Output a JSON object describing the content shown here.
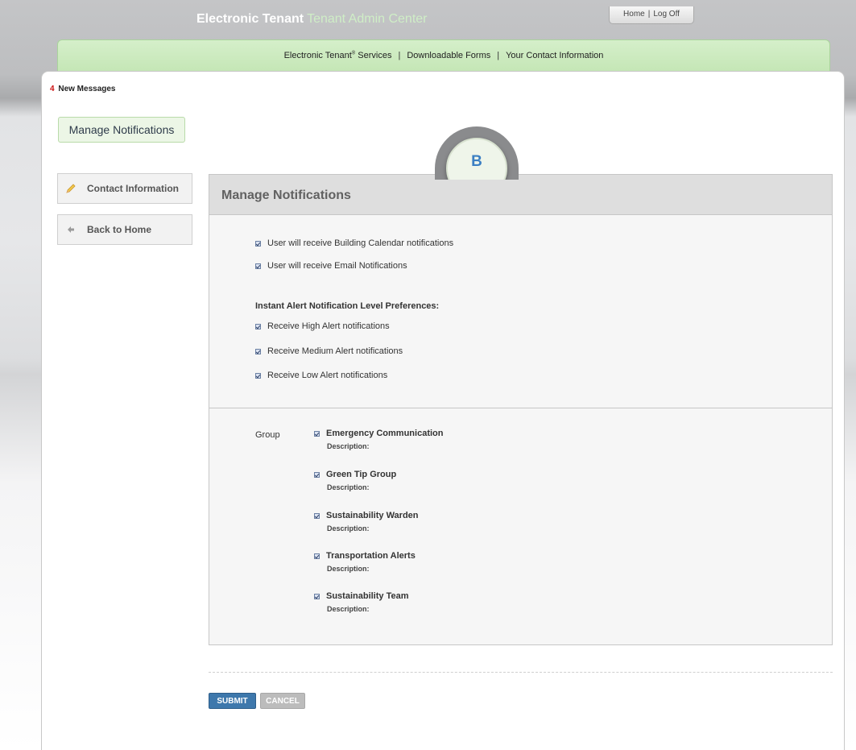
{
  "header": {
    "brand": "Electronic Tenant",
    "brand_sub": "Tenant Admin Center",
    "links": {
      "home": "Home",
      "sep": "|",
      "logoff": "Log Off"
    }
  },
  "nav": {
    "services_label": "Electronic Tenant",
    "services_suffix": " Services",
    "services_sup": "®",
    "forms": "Downloadable Forms",
    "contact": "Your Contact Information",
    "sep": "|"
  },
  "messages": {
    "count": "4",
    "label": "New Messages"
  },
  "page_title": "Manage Notifications",
  "sidebar": {
    "contact_label": "Contact Information",
    "back_label": "Back to Home"
  },
  "badge": {
    "letter": "B"
  },
  "panel": {
    "title": "Manage Notifications",
    "notifications": [
      "User will receive Building Calendar notifications",
      "User will receive Email Notifications"
    ],
    "alert_heading": "Instant Alert Notification Level Preferences:",
    "alerts": [
      "Receive High Alert notifications",
      "Receive Medium Alert notifications",
      "Receive Low Alert notifications"
    ],
    "group_label": "Group",
    "groups": [
      {
        "name": "Emergency Communication",
        "description": "Description:"
      },
      {
        "name": "Green Tip Group",
        "description": "Description:"
      },
      {
        "name": "Sustainability Warden",
        "description": "Description:"
      },
      {
        "name": "Transportation Alerts",
        "description": "Description:"
      },
      {
        "name": "Sustainability Team",
        "description": "Description:"
      }
    ]
  },
  "actions": {
    "submit": "SUBMIT",
    "cancel": "CANCEL"
  }
}
